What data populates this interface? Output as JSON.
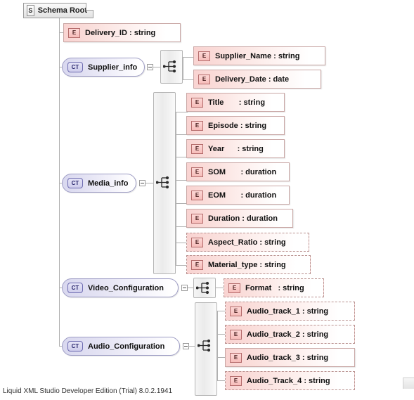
{
  "app": {
    "footer_text": "Liquid XML Studio Developer Edition (Trial) 8.0.2.1941"
  },
  "diagram": {
    "root": {
      "badge": "S",
      "label": "Schema Root"
    },
    "badges": {
      "element": "E",
      "complex_type": "CT"
    },
    "nodes": {
      "delivery_id": {
        "label": "Delivery_ID : string"
      },
      "supplier_info": {
        "label": "Supplier_info"
      },
      "supplier_name": {
        "label": "Supplier_Name : string"
      },
      "delivery_date": {
        "label": "Delivery_Date : date"
      },
      "media_info": {
        "label": "Media_info"
      },
      "title": {
        "label": "Title       : string"
      },
      "episode": {
        "label": "Episode : string"
      },
      "year": {
        "label": "Year      : string"
      },
      "som": {
        "label": "SOM       : duration"
      },
      "eom": {
        "label": "EOM       : duration"
      },
      "duration": {
        "label": "Duration : duration"
      },
      "aspect_ratio": {
        "label": "Aspect_Ratio : string"
      },
      "material_type": {
        "label": "Material_type : string"
      },
      "video_configuration": {
        "label": "Video_Configuration"
      },
      "format": {
        "label": "Format   : string"
      },
      "audio_configuration": {
        "label": "Audio_Configuration"
      },
      "audio_track_1": {
        "label": "Audio_track_1 : string"
      },
      "audio_track_2": {
        "label": "Audio_track_2 : string"
      },
      "audio_track_3": {
        "label": "Audio_track_3 : string"
      },
      "audio_track_4": {
        "label": "Audio_Track_4 : string"
      }
    },
    "colors": {
      "element_fill": "#f9d3d1",
      "element_border": "#c9a7a5",
      "complex_type_fill": "#d9d8ef",
      "complex_type_border": "#9d9cc4",
      "group_fill": "#ebebeb",
      "group_border": "#b5b5b5",
      "connector": "#b0b0b0",
      "root_fill": "#ededed"
    }
  }
}
